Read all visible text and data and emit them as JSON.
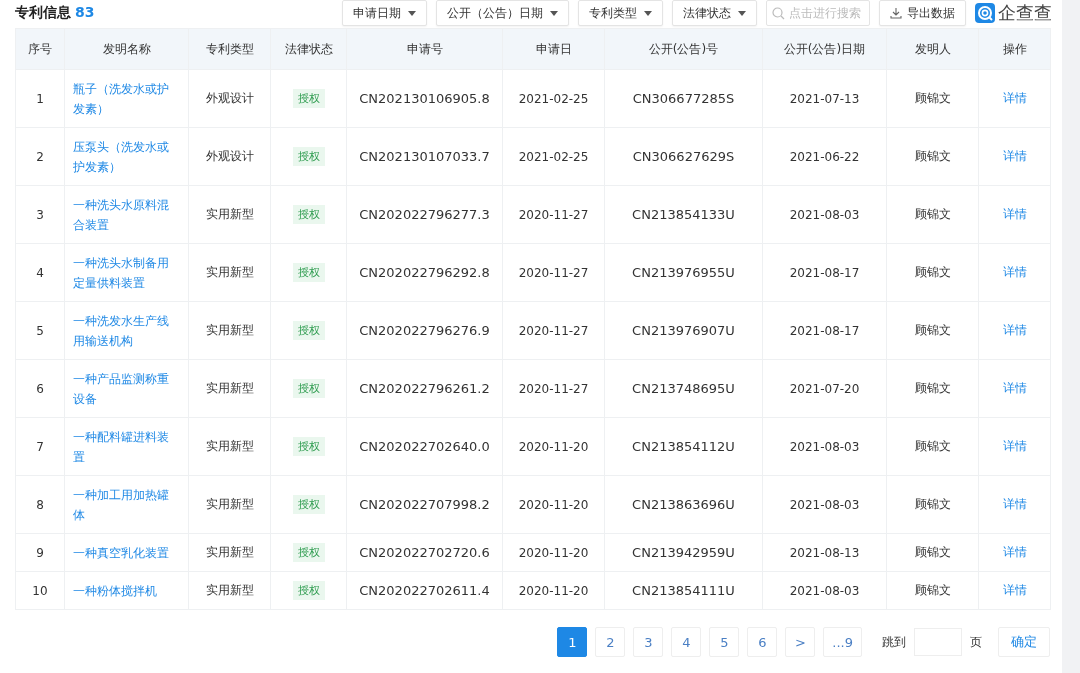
{
  "header": {
    "title": "专利信息",
    "count": "83"
  },
  "filters": [
    "申请日期",
    "公开（公告）日期",
    "专利类型",
    "法律状态"
  ],
  "search": {
    "placeholder": "点击进行搜索"
  },
  "export_button": "导出数据",
  "logo": "企查查",
  "table": {
    "columns": [
      "序号",
      "发明名称",
      "专利类型",
      "法律状态",
      "申请号",
      "申请日",
      "公开(公告)号",
      "公开(公告)日期",
      "发明人",
      "操作"
    ],
    "rows": [
      {
        "index": "1",
        "name": "瓶子（洗发水或护发素）",
        "type": "外观设计",
        "status": "授权",
        "app_no": "CN202130106905.8",
        "app_date": "2021-02-25",
        "pub_no": "CN306677285S",
        "pub_date": "2021-07-13",
        "inventor": "顾锦文",
        "action": "详情"
      },
      {
        "index": "2",
        "name": "压泵头（洗发水或护发素）",
        "type": "外观设计",
        "status": "授权",
        "app_no": "CN202130107033.7",
        "app_date": "2021-02-25",
        "pub_no": "CN306627629S",
        "pub_date": "2021-06-22",
        "inventor": "顾锦文",
        "action": "详情"
      },
      {
        "index": "3",
        "name": "一种洗头水原料混合装置",
        "type": "实用新型",
        "status": "授权",
        "app_no": "CN202022796277.3",
        "app_date": "2020-11-27",
        "pub_no": "CN213854133U",
        "pub_date": "2021-08-03",
        "inventor": "顾锦文",
        "action": "详情"
      },
      {
        "index": "4",
        "name": "一种洗头水制备用定量供料装置",
        "type": "实用新型",
        "status": "授权",
        "app_no": "CN202022796292.8",
        "app_date": "2020-11-27",
        "pub_no": "CN213976955U",
        "pub_date": "2021-08-17",
        "inventor": "顾锦文",
        "action": "详情"
      },
      {
        "index": "5",
        "name": "一种洗发水生产线用输送机构",
        "type": "实用新型",
        "status": "授权",
        "app_no": "CN202022796276.9",
        "app_date": "2020-11-27",
        "pub_no": "CN213976907U",
        "pub_date": "2021-08-17",
        "inventor": "顾锦文",
        "action": "详情"
      },
      {
        "index": "6",
        "name": "一种产品监测称重设备",
        "type": "实用新型",
        "status": "授权",
        "app_no": "CN202022796261.2",
        "app_date": "2020-11-27",
        "pub_no": "CN213748695U",
        "pub_date": "2021-07-20",
        "inventor": "顾锦文",
        "action": "详情"
      },
      {
        "index": "7",
        "name": "一种配料罐进料装置",
        "type": "实用新型",
        "status": "授权",
        "app_no": "CN202022702640.0",
        "app_date": "2020-11-20",
        "pub_no": "CN213854112U",
        "pub_date": "2021-08-03",
        "inventor": "顾锦文",
        "action": "详情"
      },
      {
        "index": "8",
        "name": "一种加工用加热罐体",
        "type": "实用新型",
        "status": "授权",
        "app_no": "CN202022707998.2",
        "app_date": "2020-11-20",
        "pub_no": "CN213863696U",
        "pub_date": "2021-08-03",
        "inventor": "顾锦文",
        "action": "详情"
      },
      {
        "index": "9",
        "name": "一种真空乳化装置",
        "type": "实用新型",
        "status": "授权",
        "app_no": "CN202022702720.6",
        "app_date": "2020-11-20",
        "pub_no": "CN213942959U",
        "pub_date": "2021-08-13",
        "inventor": "顾锦文",
        "action": "详情"
      },
      {
        "index": "10",
        "name": "一种粉体搅拌机",
        "type": "实用新型",
        "status": "授权",
        "app_no": "CN202022702611.4",
        "app_date": "2020-11-20",
        "pub_no": "CN213854111U",
        "pub_date": "2021-08-03",
        "inventor": "顾锦文",
        "action": "详情"
      }
    ]
  },
  "pagination": {
    "pages": [
      {
        "label": "1",
        "selected": true
      },
      {
        "label": "2",
        "selected": false
      },
      {
        "label": "3",
        "selected": false
      },
      {
        "label": "4",
        "selected": false
      },
      {
        "label": "5",
        "selected": false
      },
      {
        "label": "6",
        "selected": false
      },
      {
        "label": ">",
        "selected": false
      },
      {
        "label": "...9",
        "selected": false
      }
    ],
    "jump_label": "跳到",
    "page_unit": "页",
    "confirm": "确定"
  }
}
